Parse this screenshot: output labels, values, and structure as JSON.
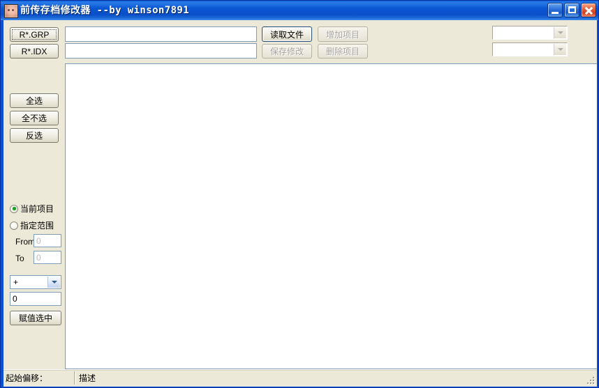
{
  "window": {
    "title": "前传存档修改器 --by winson7891",
    "icon": "app-photo-icon",
    "caption": {
      "minimize_label": "_",
      "maximize_label": "□",
      "close_label": "✕"
    },
    "frame_color": "#0a50d6",
    "client_bg": "#ece9d8"
  },
  "toolbar": {
    "grp_button": "R*.GRP",
    "idx_button": "R*.IDX",
    "grp_path_value": "",
    "grp_path_placeholder": "",
    "idx_path_value": "",
    "idx_path_placeholder": "",
    "read_file_button": "读取文件",
    "save_changes_button": "保存修改",
    "add_item_button": "增加项目",
    "delete_item_button": "删除项目",
    "combo_top_value": "",
    "combo_bottom_value": ""
  },
  "sidebar": {
    "select_all_button": "全选",
    "select_none_button": "全不选",
    "invert_selection_button": "反选",
    "radio_current_item": "当前项目",
    "radio_specified_range": "指定范围",
    "radio_selected": "当前项目",
    "from_label": "From",
    "to_label": "To",
    "from_value": "0",
    "to_value": "0",
    "operator_value": "+",
    "operator_options": [
      "+",
      "-",
      "=",
      "*",
      "/"
    ],
    "amount_value": "0",
    "assign_button": "赋值选中"
  },
  "list_panel": {
    "items": [],
    "background": "#ffffff"
  },
  "status_bar": {
    "offset_label": "起始偏移：",
    "offset_value": "",
    "description_label": "描述",
    "description_value": ""
  }
}
